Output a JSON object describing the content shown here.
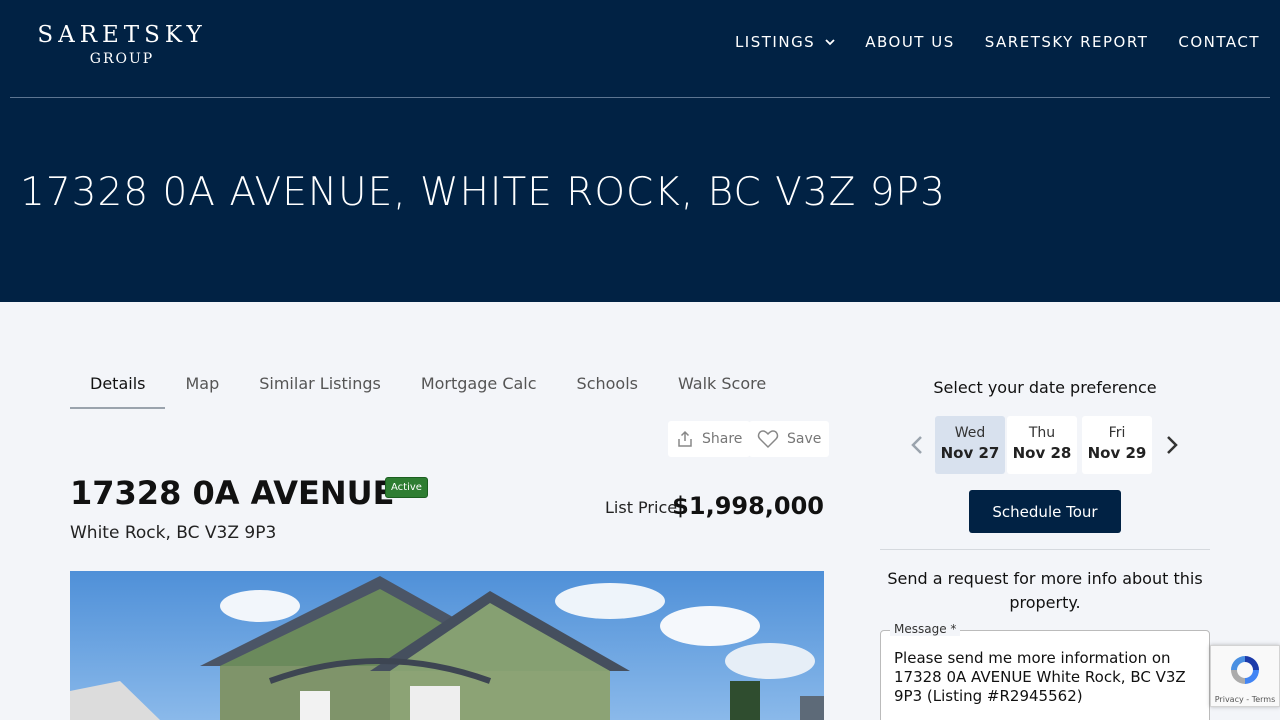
{
  "brand": {
    "name_main": "SARETSKY",
    "name_sub": "GROUP"
  },
  "nav": {
    "items": [
      {
        "label": "LISTINGS",
        "has_dropdown": true
      },
      {
        "label": "ABOUT US"
      },
      {
        "label": "SARETSKY REPORT"
      },
      {
        "label": "CONTACT"
      }
    ]
  },
  "page_title": "17328 0A AVENUE, WHITE ROCK, BC V3Z 9P3",
  "tabs": [
    {
      "label": "Details",
      "active": true
    },
    {
      "label": "Map"
    },
    {
      "label": "Similar Listings"
    },
    {
      "label": "Mortgage Calc"
    },
    {
      "label": "Schools"
    },
    {
      "label": "Walk Score"
    }
  ],
  "actions": {
    "share_label": "Share",
    "save_label": "Save"
  },
  "listing": {
    "address": "17328 0A AVENUE",
    "status": "Active",
    "city_line": "White Rock, BC V3Z 9P3",
    "price_label": "List Price",
    "price": "$1,998,000"
  },
  "tour": {
    "title": "Select your date preference",
    "dates": [
      {
        "dow": "Wed",
        "day": "Nov 27",
        "selected": true
      },
      {
        "dow": "Thu",
        "day": "Nov 28"
      },
      {
        "dow": "Fri",
        "day": "Nov 29"
      }
    ],
    "button_label": "Schedule Tour"
  },
  "request": {
    "text": "Send a request for more info about this property.",
    "message_label": "Message *",
    "message_value": "Please send me more information on 17328 0A AVENUE White Rock, BC V3Z 9P3 (Listing #R2945562)"
  },
  "recaptcha": {
    "links": "Privacy - Terms"
  },
  "colors": {
    "header_bg": "#012244",
    "page_bg": "#f3f5f9",
    "status_green": "#2e7d32"
  }
}
